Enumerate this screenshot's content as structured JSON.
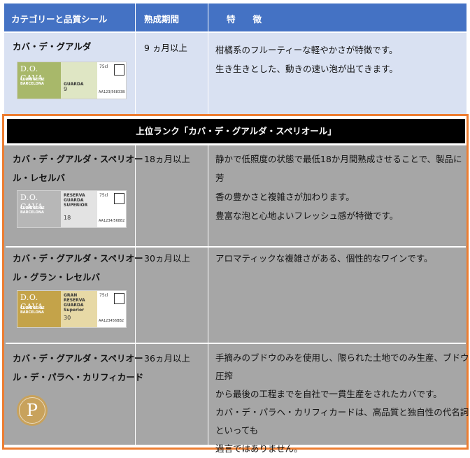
{
  "header": {
    "col1": "カテゴリーと品質シール",
    "col2": "熟成期間",
    "col3": "特　　徴"
  },
  "banner": "上位ランク「カバ・デ・グアルダ・スペリオール」",
  "rows": [
    {
      "category_lines": [
        "カバ・デ・グアルダ"
      ],
      "aging": "9 ヵ月以上",
      "feature_lines": [
        "柑橘系のフルーティーな軽やかさが特徴です。",
        "生き生きとした、動きの速い泡が出てきます。"
      ],
      "label": {
        "do": "D.O. CAVA",
        "sub": "CUPATGE DE BARCELONA",
        "kind": "GUARDA",
        "num": "9",
        "cl": "75cl",
        "code": "AA123/56833B",
        "color": "#a8b86a"
      }
    },
    {
      "category_lines": [
        "カバ・デ・グアルダ・スペリオー",
        "ル・レセルバ"
      ],
      "aging": "18ヵ月以上",
      "feature_lines": [
        "静かで低照度の状態で最低18か月間熟成させることで、製品に芳",
        "香の豊かさと複雑さが加わります。",
        "豊富な泡と心地よいフレッシュ感が特徴です。"
      ],
      "label": {
        "do": "D.O. CAVA",
        "sub": "CUPATGE DE BARCELONA",
        "kind": "RESERVA\nGUARDA SUPERIOR",
        "num": "18",
        "cl": "75cl",
        "code": "AA1234/56882",
        "color": "#b7b7b7"
      }
    },
    {
      "category_lines": [
        "カバ・デ・グアルダ・スペリオー",
        "ル・グラン・レセルバ"
      ],
      "aging": "30ヵ月以上",
      "feature_lines": [
        "アロマティックな複雑さがある、個性的なワインです。"
      ],
      "label": {
        "do": "D.O. CAVA",
        "sub": "CUPATGE DE BARCELONA",
        "kind": "GRAN RESERVA\nGUARDA Superior",
        "num": "30",
        "cl": "75cl",
        "code": "AA123456BB2",
        "color": "#c4a349"
      }
    },
    {
      "category_lines": [
        "カバ・デ・グアルダ・スペリオー",
        "ル・デ・パラヘ・カリフィカード"
      ],
      "aging": "36ヵ月以上",
      "feature_lines": [
        "手摘みのブドウのみを使用し、限られた土地でのみ生産、ブドウ圧搾",
        "から最後の工程までを自社で一貫生産をされたカバです。",
        "カバ・デ・パラヘ・カリフィカードは、高品質と独自性の代名詞といっても",
        "過言ではありません。"
      ],
      "seal": "P"
    }
  ],
  "colors": {
    "header_bg": "#4472c4",
    "row1_bg": "#d9e1f2",
    "row_bg": "#a6a6a6",
    "highlight_border": "#ed7d31",
    "banner_bg": "#000000"
  }
}
